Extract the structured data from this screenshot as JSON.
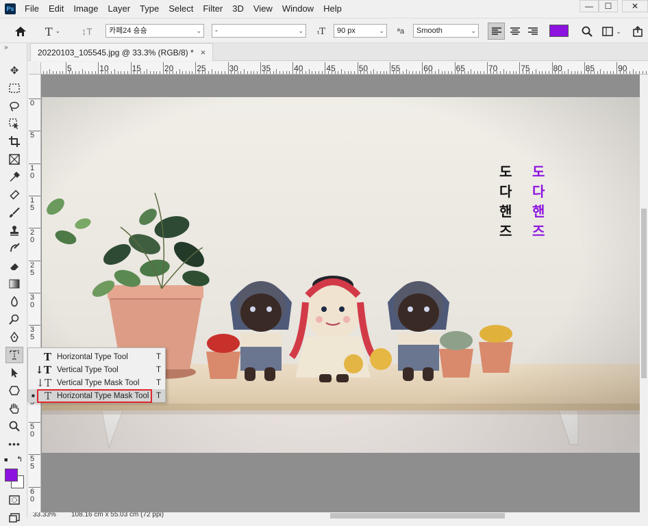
{
  "app": {
    "logo": "Ps"
  },
  "menu": [
    "File",
    "Edit",
    "Image",
    "Layer",
    "Type",
    "Select",
    "Filter",
    "3D",
    "View",
    "Window",
    "Help"
  ],
  "window_controls": {
    "minimize": "—",
    "maximize": "☐",
    "close": "✕"
  },
  "options": {
    "font_family": "카페24 숑숑",
    "font_style": "-",
    "font_size": "90 px",
    "antialias_label": "ªa",
    "antialias": "Smooth",
    "text_color": "#8c12e0"
  },
  "tab": {
    "title": "20220103_105545.jpg @ 33.3% (RGB/8) *",
    "close": "×"
  },
  "ruler_h": [
    "5",
    "10",
    "15",
    "20",
    "25",
    "30",
    "35",
    "40",
    "45",
    "50",
    "55",
    "60",
    "65",
    "70",
    "75",
    "80",
    "85",
    "90"
  ],
  "ruler_v": [
    [
      "0"
    ],
    [
      "5"
    ],
    [
      "1",
      "0"
    ],
    [
      "1",
      "5"
    ],
    [
      "2",
      "0"
    ],
    [
      "2",
      "5"
    ],
    [
      "3",
      "0"
    ],
    [
      "3",
      "5"
    ],
    [
      "4",
      "0"
    ],
    [
      "4",
      "5"
    ],
    [
      "5",
      "0"
    ],
    [
      "5",
      "5"
    ],
    [
      "6",
      "0"
    ]
  ],
  "flyout": {
    "items": [
      {
        "label": "Horizontal Type Tool",
        "shortcut": "T",
        "icon": "T"
      },
      {
        "label": "Vertical Type Tool",
        "shortcut": "T",
        "icon": "↓T"
      },
      {
        "label": "Vertical Type Mask Tool",
        "shortcut": "T",
        "icon": "↓T"
      },
      {
        "label": "Horizontal Type Mask Tool",
        "shortcut": "T",
        "icon": "T"
      }
    ]
  },
  "canvas_text": {
    "black": [
      "도",
      "다",
      "핸",
      "즈"
    ],
    "purple": [
      "도",
      "다",
      "핸",
      "즈"
    ],
    "black_color": "#111111",
    "purple_color": "#8c12e0"
  },
  "status": {
    "zoom": "33.33%",
    "doc_size": "108.16 cm x 55.03 cm (72 ppi)"
  },
  "colors": {
    "foreground": "#8c12e0",
    "background": "#ffffff"
  }
}
